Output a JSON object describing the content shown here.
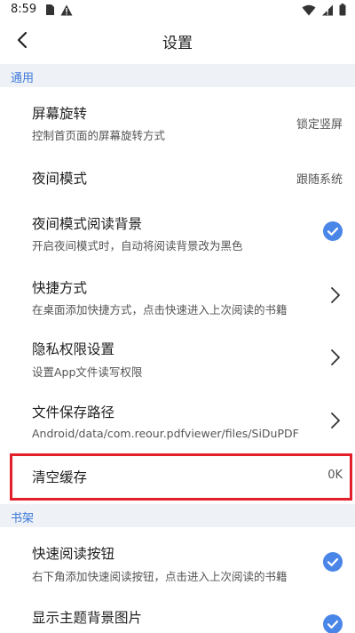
{
  "status_bar": {
    "time": "8:59"
  },
  "app_bar": {
    "title": "设置"
  },
  "sections": {
    "general": "通用",
    "bookshelf": "书架"
  },
  "settings": {
    "screen_rotation": {
      "title": "屏幕旋转",
      "subtitle": "控制首页面的屏幕旋转方式",
      "value": "锁定竖屏"
    },
    "night_mode": {
      "title": "夜间模式",
      "value": "跟随系统"
    },
    "night_reading_bg": {
      "title": "夜间模式阅读背景",
      "subtitle": "开启夜间模式时，自动将阅读背景改为黑色",
      "checked": true
    },
    "shortcut": {
      "title": "快捷方式",
      "subtitle": "在桌面添加快捷方式，点击快速进入上次阅读的书籍"
    },
    "privacy": {
      "title": "隐私权限设置",
      "subtitle": "设置App文件读写权限"
    },
    "save_path": {
      "title": "文件保存路径",
      "subtitle": "Android/data/com.reour.pdfviewer/files/SiDuPDF"
    },
    "clear_cache": {
      "title": "清空缓存",
      "value": "0K"
    },
    "quick_read_button": {
      "title": "快速阅读按钮",
      "subtitle": "右下角添加快速阅读按钮，点击进入上次阅读的书籍",
      "checked": true
    },
    "theme_bg_image": {
      "title": "显示主题背景图片",
      "checked": true
    }
  },
  "colors": {
    "accent": "#3d78d8",
    "section_bg": "#eef1f6",
    "highlight": "#e3202a",
    "check_blue": "#4a86e8"
  },
  "icons": {
    "back": "chevron-left-icon",
    "chevron": "chevron-right-icon",
    "check": "check-circle-icon"
  }
}
